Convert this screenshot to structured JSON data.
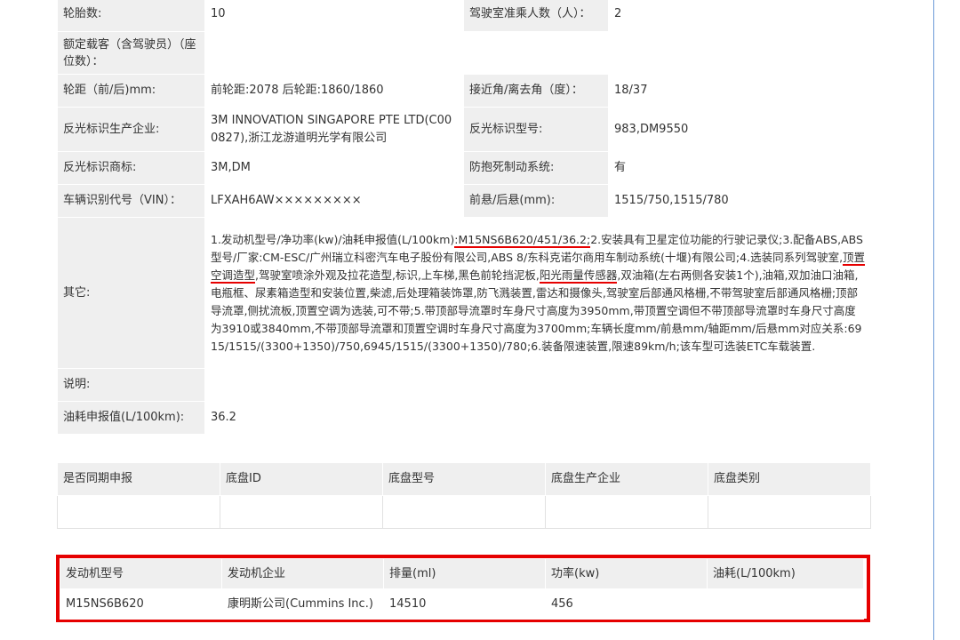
{
  "vehicle_params": {
    "rows": [
      {
        "l1": "轮胎数:",
        "v1": "10",
        "l2": "驾驶室准乘人数（人）：",
        "v2": "2"
      },
      {
        "l1": "额定载客（含驾驶员）（座位数）：",
        "v1": ""
      },
      {
        "l1": "轮距（前/后)mm:",
        "v1": "前轮距:2078 后轮距:1860/1860",
        "l2": "接近角/离去角（度）：",
        "v2": "18/37"
      },
      {
        "l1": "反光标识生产企业:",
        "v1": "3M INNOVATION SINGAPORE PTE LTD(C000827),浙江龙游道明光学有限公司",
        "l2": "反光标识型号:",
        "v2": "983,DM9550"
      },
      {
        "l1": "反光标识商标:",
        "v1": "3M,DM",
        "l2": "防抱死制动系统:",
        "v2": "有"
      },
      {
        "l1": "车辆识别代号（VIN）：",
        "v1": "LFXAH6AW×××××××××",
        "l2": "前悬/后悬(mm):",
        "v2": "1515/750,1515/780"
      }
    ],
    "other_label": "其它:",
    "other_parts": [
      "1.发动机型号/净功率(kw)/油耗申报值(L/100km)",
      ":M15NS6B620/451/36.2;",
      "2.安装具有卫星定位功能的行驶记录仪;3.配备ABS,ABS型号/厂家:CM-ESC/广州瑞立科密汽车电子股份有限公司,ABS 8/东科克诺尔商用车制动系统(十堰)有限公司;4.选装同系列驾驶室,",
      "顶置空调造型",
      ",驾驶室喷涂外观及拉花造型,标识,上车梯,黑色前轮挡泥板,",
      "阳光雨量传感器",
      ",双油箱(左右两侧各安装1个),油箱,双加油口油箱,电瓶框、尿素箱造型和安装位置,柴滤,后处理箱装饰罩,防飞溅装置,雷达和摄像头,驾驶室后部通风格栅,不带驾驶室后部通风格栅;顶部导流罩,侧扰流板,顶置空调为选装,可不带;5.带顶部导流罩时车身尺寸高度为3950mm,带顶置空调但不带顶部导流罩时车身尺寸高度为3910或3840mm,不带顶部导流罩和顶置空调时车身尺寸高度为3700mm;车辆长度mm/前悬mm/轴距mm/后悬mm对应关系:6915/1515/(3300+1350)/750,6945/1515/(3300+1350)/780;6.装备限速装置,限速89km/h;该车型可选装ETC车载装置."
    ],
    "note_label": "说明:",
    "note_value": "",
    "fuel_label": "油耗申报值(L/100km):",
    "fuel_value": "36.2"
  },
  "chassis": {
    "headers": [
      "是否同期申报",
      "底盘ID",
      "底盘型号",
      "底盘生产企业",
      "底盘类别"
    ]
  },
  "engine": {
    "headers": [
      "发动机型号",
      "发动机企业",
      "排量(ml)",
      "功率(kw)",
      "油耗(L/100km)"
    ],
    "values": [
      "M15NS6B620",
      "康明斯公司(Cummins Inc.)",
      "14510",
      "456",
      ""
    ]
  },
  "colors": {
    "highlight": "#e60000",
    "label_bg": "#efefef"
  }
}
